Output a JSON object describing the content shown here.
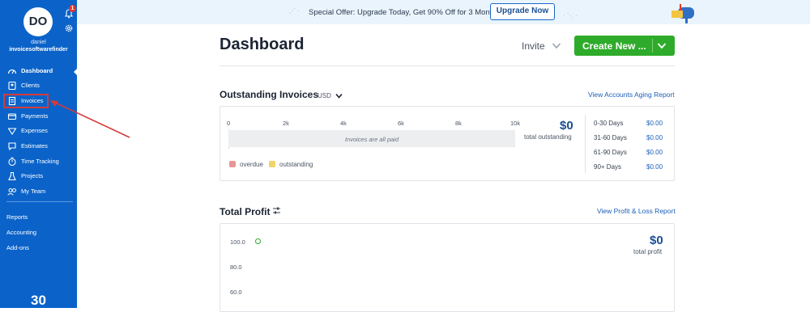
{
  "sidebar": {
    "avatar_initials": "DO",
    "notification_count": "1",
    "user_first": "daniel",
    "user_org": "invoicesoftwarefinder",
    "items": [
      {
        "label": "Dashboard",
        "icon": "dashboard-icon"
      },
      {
        "label": "Clients",
        "icon": "clients-icon"
      },
      {
        "label": "Invoices",
        "icon": "invoices-icon"
      },
      {
        "label": "Payments",
        "icon": "payments-icon"
      },
      {
        "label": "Expenses",
        "icon": "expenses-icon"
      },
      {
        "label": "Estimates",
        "icon": "estimates-icon"
      },
      {
        "label": "Time Tracking",
        "icon": "time-tracking-icon"
      },
      {
        "label": "Projects",
        "icon": "projects-icon"
      },
      {
        "label": "My Team",
        "icon": "team-icon"
      }
    ],
    "lower_items": [
      "Reports",
      "Accounting",
      "Add-ons"
    ],
    "trial_days": "30"
  },
  "banner": {
    "text": "Special Offer: Upgrade Today, Get 90% Off for 3 Months.",
    "button": "Upgrade Now"
  },
  "header": {
    "title": "Dashboard",
    "invite": "Invite",
    "create_new": "Create New ..."
  },
  "outstanding": {
    "title": "Outstanding Invoices",
    "currency": "USD",
    "report_link": "View Accounts Aging Report",
    "ticks": [
      "0",
      "2k",
      "4k",
      "6k",
      "8k",
      "10k"
    ],
    "bar_text": "Invoices are all paid",
    "legend": [
      "overdue",
      "outstanding"
    ],
    "total_amount": "$0",
    "total_label": "total outstanding",
    "aging": [
      {
        "label": "0-30 Days",
        "value": "$0.00"
      },
      {
        "label": "31-60 Days",
        "value": "$0.00"
      },
      {
        "label": "61-90 Days",
        "value": "$0.00"
      },
      {
        "label": "90+ Days",
        "value": "$0.00"
      }
    ]
  },
  "profit": {
    "title": "Total Profit",
    "report_link": "View Profit & Loss Report",
    "total_amount": "$0",
    "total_label": "total profit",
    "y_ticks": [
      "100.0",
      "80.0",
      "60.0"
    ]
  },
  "colors": {
    "sidebar": "#0b63c9",
    "primary_button": "#2eab2a",
    "link": "#1b5fb8",
    "overdue": "#e89597",
    "outstanding": "#f3d36b",
    "annotation": "#d63a3a"
  }
}
